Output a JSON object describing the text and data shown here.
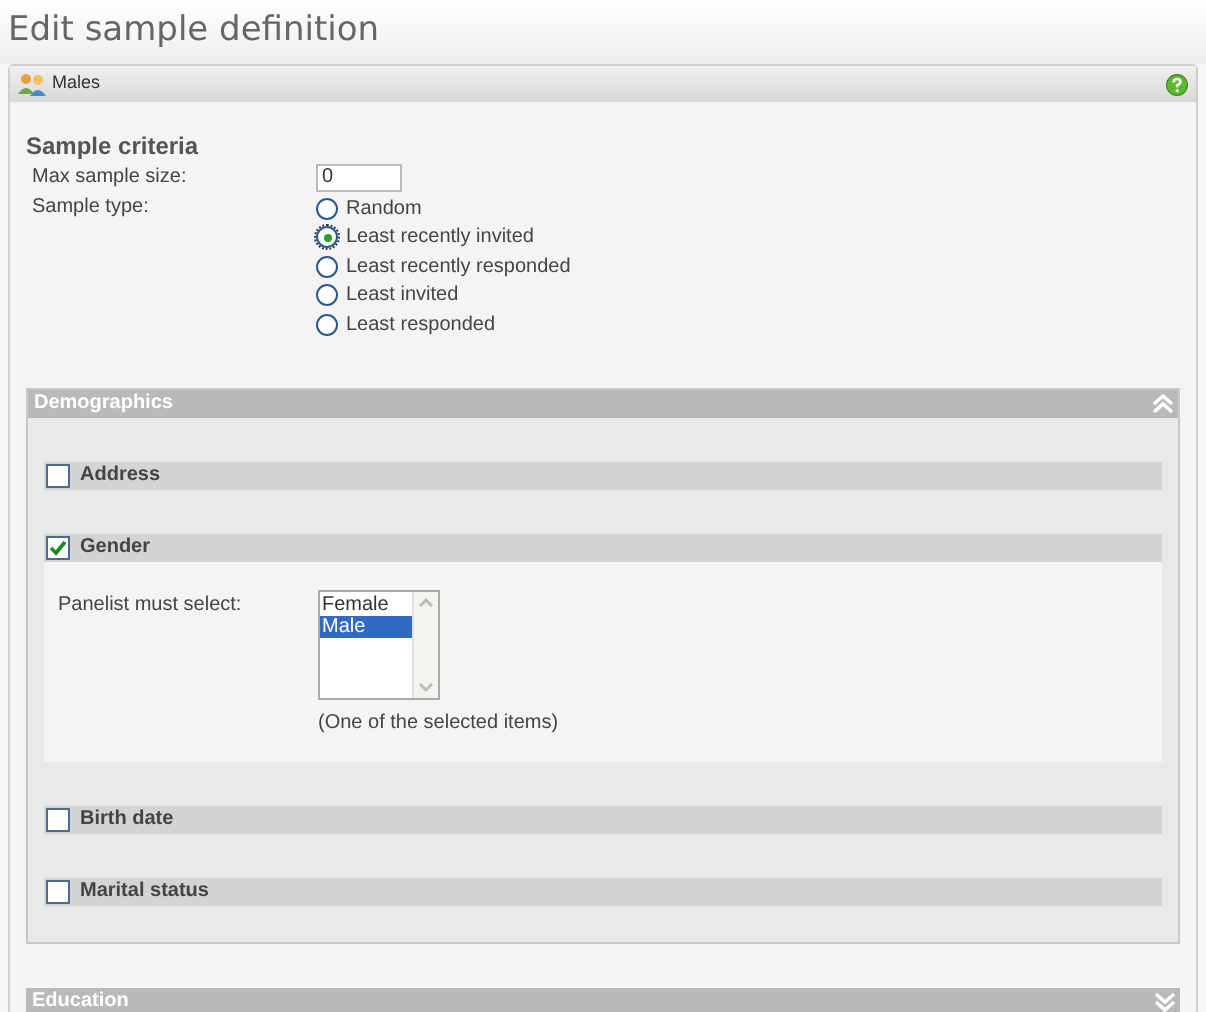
{
  "page_title": "Edit sample definition",
  "panel": {
    "title": "Males"
  },
  "criteria": {
    "heading": "Sample criteria",
    "max_label": "Max sample size:",
    "max_value": "0",
    "type_label": "Sample type:",
    "options": [
      {
        "label": "Random",
        "selected": false
      },
      {
        "label": "Least recently invited",
        "selected": true
      },
      {
        "label": "Least recently responded",
        "selected": false
      },
      {
        "label": "Least invited",
        "selected": false
      },
      {
        "label": "Least responded",
        "selected": false
      }
    ]
  },
  "sections": [
    {
      "title": "Demographics",
      "expanded": true,
      "groups": [
        {
          "label": "Address",
          "checked": false
        },
        {
          "label": "Gender",
          "checked": true,
          "field_label": "Panelist must select:",
          "items": [
            {
              "label": "Female",
              "selected": false
            },
            {
              "label": "Male",
              "selected": true
            }
          ],
          "hint": "(One of the selected items)"
        },
        {
          "label": "Birth date",
          "checked": false
        },
        {
          "label": "Marital status",
          "checked": false
        }
      ]
    },
    {
      "title": "Education",
      "expanded": false
    }
  ]
}
